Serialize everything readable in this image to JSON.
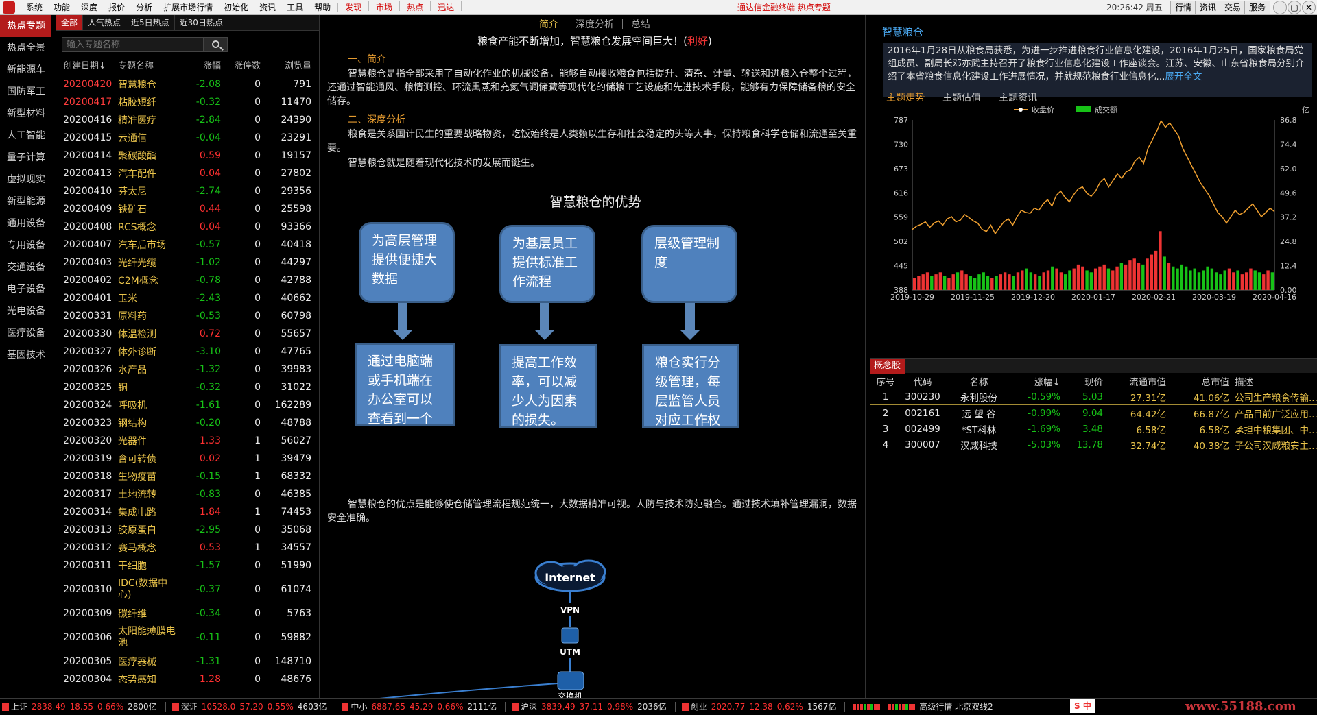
{
  "menubar": {
    "items": [
      "系统",
      "功能",
      "深度",
      "报价",
      "分析",
      "扩展市场行情",
      "初始化",
      "资讯",
      "工具",
      "帮助"
    ],
    "red_items": [
      "发现",
      "市场",
      "热点",
      "迅达"
    ],
    "center_text": "通达信金融终端  热点专题",
    "time": "20:26:42 周五",
    "right_buttons": [
      "行情",
      "资讯",
      "交易",
      "服务"
    ],
    "window_buttons": [
      "–",
      "▢",
      "✕"
    ]
  },
  "sidenav": {
    "items": [
      "热点专题",
      "热点全景",
      "新能源车",
      "国防军工",
      "新型材料",
      "人工智能",
      "量子计算",
      "虚拟现实",
      "新型能源",
      "通用设备",
      "专用设备",
      "交通设备",
      "电子设备",
      "光电设备",
      "医疗设备",
      "基因技术"
    ]
  },
  "topics": {
    "tabs": [
      "全部",
      "人气热点",
      "近5日热点",
      "近30日热点"
    ],
    "search_placeholder": "输入专题名称",
    "headers": [
      "创建日期↓",
      "专题名称",
      "涨幅",
      "涨停数",
      "浏览量"
    ],
    "rows": [
      {
        "date": "20200420",
        "name": "智慧粮仓",
        "chg": "-2.08",
        "limit": "0",
        "views": "791"
      },
      {
        "date": "20200417",
        "name": "粘胶短纤",
        "chg": "-0.32",
        "limit": "0",
        "views": "11470"
      },
      {
        "date": "20200416",
        "name": "精准医疗",
        "chg": "-2.84",
        "limit": "0",
        "views": "24390"
      },
      {
        "date": "20200415",
        "name": "云通信",
        "chg": "-0.04",
        "limit": "0",
        "views": "23291"
      },
      {
        "date": "20200414",
        "name": "聚碳酸酯",
        "chg": "0.59",
        "limit": "0",
        "views": "19157"
      },
      {
        "date": "20200413",
        "name": "汽车配件",
        "chg": "0.04",
        "limit": "0",
        "views": "27802"
      },
      {
        "date": "20200410",
        "name": "芬太尼",
        "chg": "-2.74",
        "limit": "0",
        "views": "29356"
      },
      {
        "date": "20200409",
        "name": "铁矿石",
        "chg": "0.44",
        "limit": "0",
        "views": "25598"
      },
      {
        "date": "20200408",
        "name": "RCS概念",
        "chg": "0.04",
        "limit": "0",
        "views": "93366"
      },
      {
        "date": "20200407",
        "name": "汽车后市场",
        "chg": "-0.57",
        "limit": "0",
        "views": "40418"
      },
      {
        "date": "20200403",
        "name": "光纤光缆",
        "chg": "-1.02",
        "limit": "0",
        "views": "44297"
      },
      {
        "date": "20200402",
        "name": "C2M概念",
        "chg": "-0.78",
        "limit": "0",
        "views": "42788"
      },
      {
        "date": "20200401",
        "name": "玉米",
        "chg": "-2.43",
        "limit": "0",
        "views": "40662"
      },
      {
        "date": "20200331",
        "name": "原料药",
        "chg": "-0.53",
        "limit": "0",
        "views": "60798"
      },
      {
        "date": "20200330",
        "name": "体温检测",
        "chg": "0.72",
        "limit": "0",
        "views": "55657"
      },
      {
        "date": "20200327",
        "name": "体外诊断",
        "chg": "-3.10",
        "limit": "0",
        "views": "47765"
      },
      {
        "date": "20200326",
        "name": "水产品",
        "chg": "-1.32",
        "limit": "0",
        "views": "39983"
      },
      {
        "date": "20200325",
        "name": "铜",
        "chg": "-0.32",
        "limit": "0",
        "views": "31022"
      },
      {
        "date": "20200324",
        "name": "呼吸机",
        "chg": "-1.61",
        "limit": "0",
        "views": "162289"
      },
      {
        "date": "20200323",
        "name": "钢结构",
        "chg": "-0.20",
        "limit": "0",
        "views": "48788"
      },
      {
        "date": "20200320",
        "name": "光器件",
        "chg": "1.33",
        "limit": "1",
        "views": "56027"
      },
      {
        "date": "20200319",
        "name": "含可转债",
        "chg": "0.02",
        "limit": "1",
        "views": "39479"
      },
      {
        "date": "20200318",
        "name": "生物疫苗",
        "chg": "-0.15",
        "limit": "1",
        "views": "68332"
      },
      {
        "date": "20200317",
        "name": "土地流转",
        "chg": "-0.83",
        "limit": "0",
        "views": "46385"
      },
      {
        "date": "20200314",
        "name": "集成电路",
        "chg": "1.84",
        "limit": "1",
        "views": "74453"
      },
      {
        "date": "20200313",
        "name": "胶原蛋白",
        "chg": "-2.95",
        "limit": "0",
        "views": "35068"
      },
      {
        "date": "20200312",
        "name": "赛马概念",
        "chg": "0.53",
        "limit": "1",
        "views": "34557"
      },
      {
        "date": "20200311",
        "name": "干细胞",
        "chg": "-1.57",
        "limit": "0",
        "views": "51990"
      },
      {
        "date": "20200310",
        "name": "IDC(数据中心)",
        "chg": "-0.37",
        "limit": "0",
        "views": "61074",
        "tall": true
      },
      {
        "date": "20200309",
        "name": "碳纤维",
        "chg": "-0.34",
        "limit": "0",
        "views": "5763"
      },
      {
        "date": "20200306",
        "name": "太阳能薄膜电池",
        "chg": "-0.11",
        "limit": "0",
        "views": "59882",
        "tall": true
      },
      {
        "date": "20200305",
        "name": "医疗器械",
        "chg": "-1.31",
        "limit": "0",
        "views": "148710"
      },
      {
        "date": "20200304",
        "name": "态势感知",
        "chg": "1.28",
        "limit": "0",
        "views": "48676"
      }
    ]
  },
  "article": {
    "tabs": [
      "简介",
      "深度分析",
      "总结"
    ],
    "title_main": "粮食产能不断增加，智慧粮仓发展空间巨大！(",
    "title_tag": "利好",
    "title_end": ")",
    "sec1": "一、简介",
    "para1": "智慧粮仓是指全部采用了自动化作业的机械设备，能够自动接收粮食包括提升、清杂、计量、输送和进粮入仓整个过程，还通过智能通风、粮情测控、环流熏蒸和充氮气调储藏等现代化的储粮工艺设施和先进技术手段，能够有力保障储备粮的安全储存。",
    "sec2": "二、深度分析",
    "para2": "粮食是关系国计民生的重要战略物资，吃饭始终是人类赖以生存和社会稳定的头等大事，保持粮食科学仓储和流通至关重要。",
    "para2b": "智慧粮仓就是随着现代化技术的发展而诞生。",
    "diagram_title": "智慧粮仓的优势",
    "top_boxes": [
      "为高层管理提供便捷大数据",
      "为基层员工提供标准工作流程",
      "层级管理制度"
    ],
    "bottom_boxes": [
      "通过电脑端或手机端在办公室可以查看到一个",
      "提高工作效率，可以减少人为因素的损失。",
      "粮仓实行分级管理，每层监管人员对应工作权"
    ],
    "para3": "智慧粮仓的优点是能够使仓储管理流程规范统一，大数据精准可视。人防与技术防范融合。通过技术填补管理漏洞，数据安全准确。",
    "net_labels": [
      "Internet",
      "VPN",
      "UTM",
      "交换机"
    ]
  },
  "right": {
    "title": "智慧粮仓",
    "desc": "2016年1月28日从粮食局获悉，为进一步推进粮食行业信息化建设，2016年1月25日，国家粮食局党组成员、副局长邓亦武主持召开了粮食行业信息化建设工作座谈会。江苏、安徽、山东省粮食局分别介绍了本省粮食信息化建设工作进展情况，并就规范粮食行业信息化...",
    "more": "展开全文",
    "tabs": [
      "主题走势",
      "主题估值",
      "主题资讯"
    ],
    "concept_label": "概念股",
    "concept_headers": [
      "序号",
      "代码",
      "名称",
      "涨幅↓",
      "现价",
      "流通市值",
      "总市值",
      "描述"
    ],
    "concept_rows": [
      {
        "n": "1",
        "code": "300230",
        "name": "永利股份",
        "chg": "-0.59%",
        "price": "5.03",
        "float": "27.31亿",
        "total": "41.06亿",
        "desc": "公司生产粮食传输..."
      },
      {
        "n": "2",
        "code": "002161",
        "name": "远 望 谷",
        "chg": "-0.99%",
        "price": "9.04",
        "float": "64.42亿",
        "total": "66.87亿",
        "desc": "产品目前广泛应用..."
      },
      {
        "n": "3",
        "code": "002499",
        "name": "*ST科林",
        "chg": "-1.69%",
        "price": "3.48",
        "float": "6.58亿",
        "total": "6.58亿",
        "desc": "承担中粮集团、中..."
      },
      {
        "n": "4",
        "code": "300007",
        "name": "汉威科技",
        "chg": "-5.03%",
        "price": "13.78",
        "float": "32.74亿",
        "total": "40.38亿",
        "desc": "子公司汉威粮安主..."
      }
    ]
  },
  "chart_data": {
    "type": "line",
    "legend": [
      "收盘价",
      "成交额"
    ],
    "right_unit": "亿",
    "y_left_ticks": [
      388,
      445,
      502,
      559,
      616,
      673,
      730,
      787
    ],
    "y_right_ticks": [
      "0.00",
      "12.4",
      "24.8",
      "37.2",
      "49.6",
      "62.0",
      "74.4",
      "86.8"
    ],
    "x_ticks": [
      "2019-10-29",
      "2019-11-25",
      "2019-12-20",
      "2020-01-17",
      "2020-02-21",
      "2020-03-19",
      "2020-04-16"
    ],
    "ylim": [
      388,
      787
    ],
    "close": [
      530,
      538,
      542,
      548,
      535,
      545,
      550,
      540,
      555,
      560,
      548,
      552,
      565,
      558,
      550,
      545,
      530,
      525,
      540,
      520,
      535,
      548,
      555,
      540,
      560,
      575,
      570,
      568,
      580,
      575,
      590,
      600,
      585,
      610,
      620,
      605,
      595,
      612,
      625,
      630,
      615,
      608,
      620,
      640,
      650,
      630,
      645,
      660,
      650,
      665,
      670,
      690,
      700,
      685,
      720,
      740,
      760,
      785,
      770,
      780,
      765,
      750,
      720,
      700,
      680,
      660,
      640,
      625,
      610,
      590,
      570,
      560,
      545,
      560,
      575,
      565,
      570,
      580,
      590,
      575,
      560,
      570,
      580,
      572
    ],
    "volume": [
      6,
      7,
      8,
      9,
      7,
      8,
      9,
      7,
      6,
      8,
      9,
      10,
      8,
      7,
      6,
      8,
      9,
      7,
      6,
      7,
      8,
      9,
      8,
      7,
      9,
      10,
      11,
      9,
      8,
      7,
      9,
      10,
      12,
      11,
      9,
      8,
      10,
      11,
      13,
      12,
      10,
      9,
      11,
      12,
      13,
      11,
      10,
      12,
      14,
      13,
      15,
      16,
      14,
      13,
      16,
      18,
      20,
      30,
      17,
      14,
      12,
      11,
      13,
      12,
      10,
      11,
      9,
      10,
      12,
      11,
      9,
      8,
      10,
      11,
      9,
      10,
      8,
      9,
      11,
      10,
      9,
      8,
      10,
      9
    ],
    "volume_ylim": [
      0,
      86.8
    ]
  },
  "status": {
    "items": [
      {
        "name": "上证",
        "v": "2838.49",
        "c": "18.55",
        "p": "0.66%",
        "a": "2800亿"
      },
      {
        "name": "深证",
        "v": "10528.0",
        "c": "57.20",
        "p": "0.55%",
        "a": "4603亿"
      },
      {
        "name": "中小",
        "v": "6887.65",
        "c": "45.29",
        "p": "0.66%",
        "a": "2111亿"
      },
      {
        "name": "沪深",
        "v": "3839.49",
        "c": "37.11",
        "p": "0.98%",
        "a": "2036亿"
      },
      {
        "name": "创业",
        "v": "2020.77",
        "c": "12.38",
        "p": "0.62%",
        "a": "1567亿"
      }
    ],
    "right_text": "高级行情 北京双线2",
    "watermark": "www.55188.com",
    "ime": "S 中"
  },
  "colors": {
    "up": "#ff3030",
    "down": "#17c217",
    "accent": "#b31b1b",
    "gold": "#e8c24a",
    "blue": "#4f81bd"
  }
}
